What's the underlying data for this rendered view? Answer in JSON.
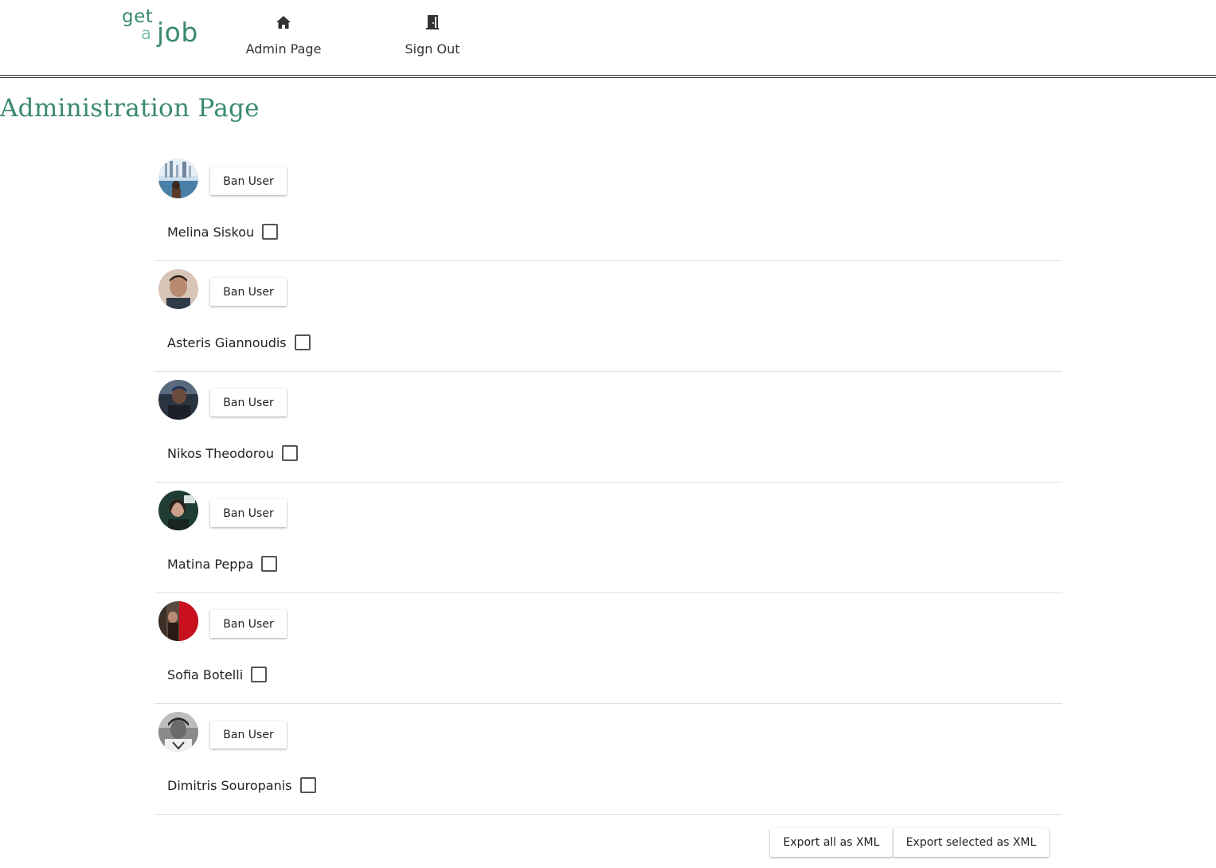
{
  "logo": {
    "get": "get",
    "a": "a",
    "job": "job"
  },
  "nav": {
    "admin_page": {
      "label": "Admin Page",
      "icon": "home-icon"
    },
    "sign_out": {
      "label": "Sign Out",
      "icon": "door-exit-icon"
    }
  },
  "page": {
    "title": "Administration Page"
  },
  "users": [
    {
      "name": "Melina Siskou",
      "ban_label": "Ban User",
      "checked": false
    },
    {
      "name": "Asteris Giannoudis",
      "ban_label": "Ban User",
      "checked": false
    },
    {
      "name": "Nikos Theodorou",
      "ban_label": "Ban User",
      "checked": false
    },
    {
      "name": "Matina Peppa",
      "ban_label": "Ban User",
      "checked": false
    },
    {
      "name": "Sofia Botelli",
      "ban_label": "Ban User",
      "checked": false
    },
    {
      "name": "Dimitris Souropanis",
      "ban_label": "Ban User",
      "checked": false
    }
  ],
  "export": {
    "all_label": "Export all as XML",
    "selected_label": "Export selected as XML"
  },
  "colors": {
    "brand": "#3a8a6e",
    "brand_light": "#7fc3a9"
  }
}
